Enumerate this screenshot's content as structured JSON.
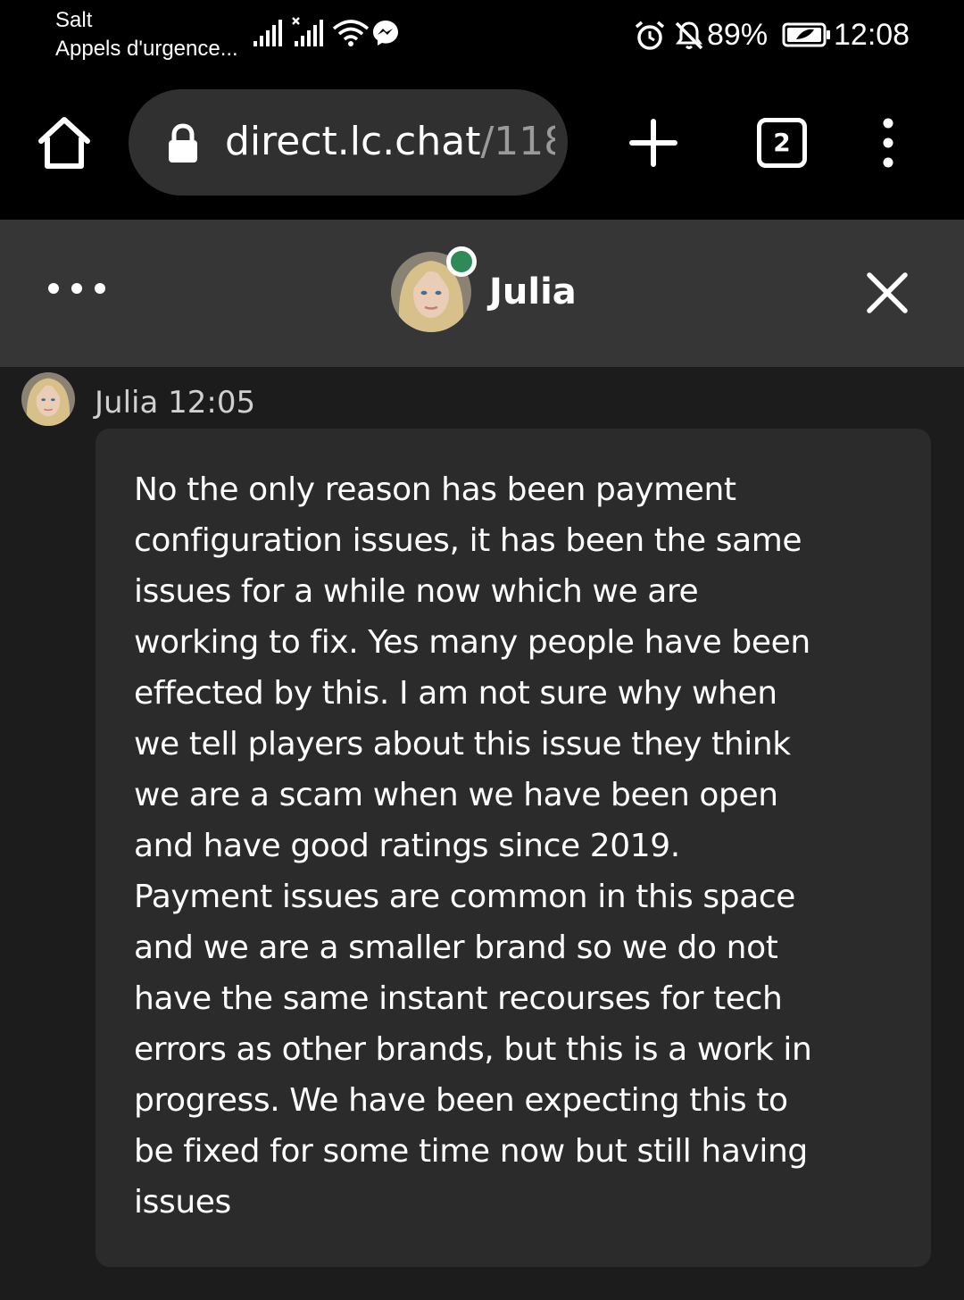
{
  "status_bar": {
    "carrier": "Salt",
    "carrier_sub": "Appels d'urgence...",
    "battery_percent": "89%",
    "time": "12:08",
    "icons": [
      "signal-bars-icon",
      "signal-bars-no-sim-icon",
      "wifi-icon",
      "messenger-icon",
      "alarm-icon",
      "notifications-muted-icon",
      "battery-saver-icon"
    ]
  },
  "browser": {
    "url_domain": "direct.lc.chat",
    "url_path": "/118",
    "tab_count": "2",
    "icons": [
      "home-icon",
      "lock-icon",
      "plus-icon",
      "more-vert-icon"
    ]
  },
  "chat_header": {
    "agent_name": "Julia",
    "status_color": "#2e8b57",
    "icons": [
      "more-horiz-icon",
      "close-icon"
    ]
  },
  "messages": [
    {
      "sender": "Julia",
      "time": "12:05",
      "meta": "Julia 12:05",
      "lines": [
        "No the only reason has been payment",
        "configuration issues, it has been the same",
        "issues for a while now which we are",
        "working to fix. Yes many people have been",
        "effected by this. I am not sure why when",
        "we tell players about this issue they think",
        "we are a scam when we have been open",
        "and have good ratings since 2019.",
        "Payment issues are common in this space",
        "and we are a smaller brand so we do not",
        "have the same instant recourses for tech",
        "errors as other brands, but this is a work in",
        "progress. We have been expecting this to",
        "be fixed for some time now but still having",
        "issues"
      ]
    }
  ]
}
